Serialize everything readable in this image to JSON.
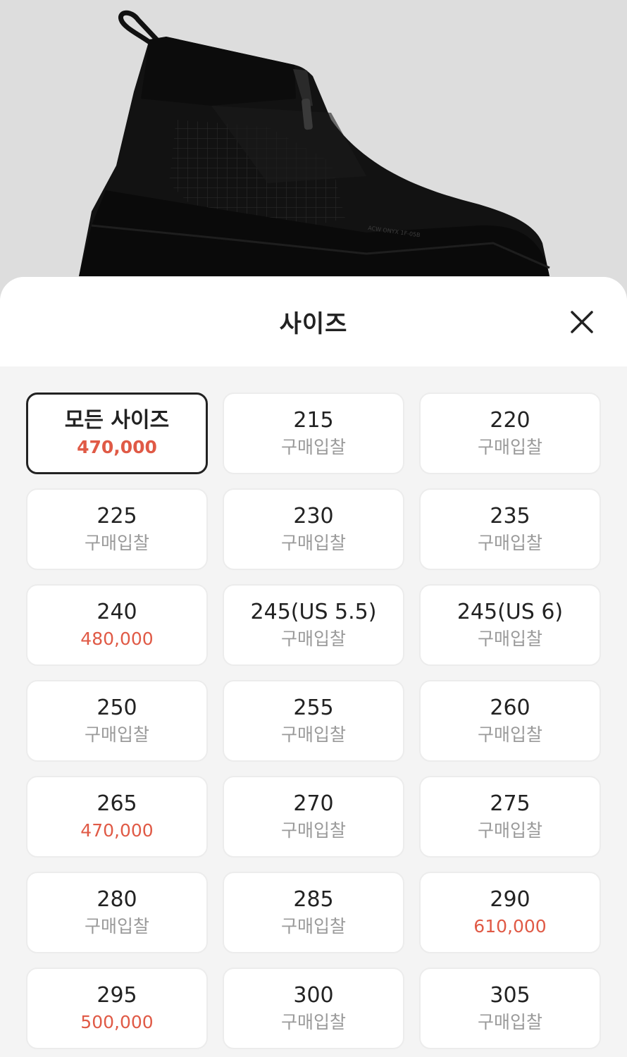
{
  "product": {
    "image_icon": "black-high-top-shoe-image",
    "print_text": "ACW ONYX 1F-05B"
  },
  "sheet": {
    "title": "사이즈",
    "close_icon": "close-icon"
  },
  "colors": {
    "price_accent": "#e05a46",
    "muted_text": "#9a9a9a",
    "selected_border": "#222222"
  },
  "sizes": [
    {
      "label": "모든 사이즈",
      "price": "470,000",
      "has_price": true,
      "selected": true
    },
    {
      "label": "215",
      "price": "구매입찰",
      "has_price": false
    },
    {
      "label": "220",
      "price": "구매입찰",
      "has_price": false
    },
    {
      "label": "225",
      "price": "구매입찰",
      "has_price": false
    },
    {
      "label": "230",
      "price": "구매입찰",
      "has_price": false
    },
    {
      "label": "235",
      "price": "구매입찰",
      "has_price": false
    },
    {
      "label": "240",
      "price": "480,000",
      "has_price": true
    },
    {
      "label": "245(US 5.5)",
      "price": "구매입찰",
      "has_price": false
    },
    {
      "label": "245(US 6)",
      "price": "구매입찰",
      "has_price": false
    },
    {
      "label": "250",
      "price": "구매입찰",
      "has_price": false
    },
    {
      "label": "255",
      "price": "구매입찰",
      "has_price": false
    },
    {
      "label": "260",
      "price": "구매입찰",
      "has_price": false
    },
    {
      "label": "265",
      "price": "470,000",
      "has_price": true
    },
    {
      "label": "270",
      "price": "구매입찰",
      "has_price": false
    },
    {
      "label": "275",
      "price": "구매입찰",
      "has_price": false
    },
    {
      "label": "280",
      "price": "구매입찰",
      "has_price": false
    },
    {
      "label": "285",
      "price": "구매입찰",
      "has_price": false
    },
    {
      "label": "290",
      "price": "610,000",
      "has_price": true
    },
    {
      "label": "295",
      "price": "500,000",
      "has_price": true
    },
    {
      "label": "300",
      "price": "구매입찰",
      "has_price": false
    },
    {
      "label": "305",
      "price": "구매입찰",
      "has_price": false
    }
  ]
}
